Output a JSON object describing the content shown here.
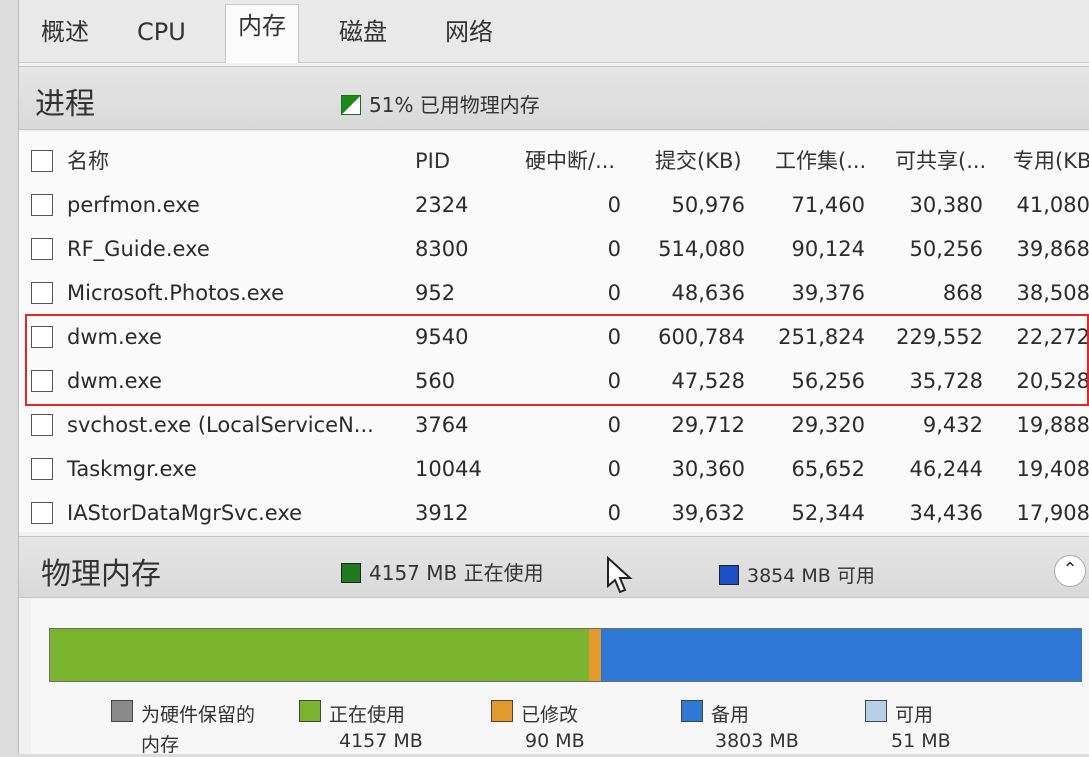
{
  "tabs": [
    "概述",
    "CPU",
    "内存",
    "磁盘",
    "网络"
  ],
  "process_section": {
    "title": "进程",
    "summary": "51% 已用物理内存",
    "summary_color": "#1d8a1d"
  },
  "table": {
    "columns": [
      "名称",
      "PID",
      "硬中断/...",
      "提交(KB)",
      "工作集(...",
      "可共享(...",
      "专用(KB"
    ],
    "rows": [
      [
        "perfmon.exe",
        "2324",
        "0",
        "50,976",
        "71,460",
        "30,380",
        "41,080"
      ],
      [
        "RF_Guide.exe",
        "8300",
        "0",
        "514,080",
        "90,124",
        "50,256",
        "39,868"
      ],
      [
        "Microsoft.Photos.exe",
        "952",
        "0",
        "48,636",
        "39,376",
        "868",
        "38,508"
      ],
      [
        "dwm.exe",
        "9540",
        "0",
        "600,784",
        "251,824",
        "229,552",
        "22,272"
      ],
      [
        "dwm.exe",
        "560",
        "0",
        "47,528",
        "56,256",
        "35,728",
        "20,528"
      ],
      [
        "svchost.exe (LocalServiceN...",
        "3764",
        "0",
        "29,712",
        "29,320",
        "9,432",
        "19,888"
      ],
      [
        "Taskmgr.exe",
        "10044",
        "0",
        "30,360",
        "65,652",
        "46,244",
        "19,408"
      ],
      [
        "IAStorDataMgrSvc.exe",
        "3912",
        "0",
        "39,632",
        "52,344",
        "34,436",
        "17,908"
      ]
    ]
  },
  "memory_section": {
    "title": "物理内存",
    "in_use_summary": "4157 MB 正在使用",
    "available_summary": "3854 MB 可用",
    "in_use_color": "#1f7a1f",
    "available_color": "#1b4fc8"
  },
  "memory_bar": {
    "segments": [
      {
        "name": "reserved",
        "fraction": 0.0,
        "color": "#8a8a8a"
      },
      {
        "name": "in-use",
        "fraction": 0.5225,
        "color": "#7ab32e"
      },
      {
        "name": "modified",
        "fraction": 0.0113,
        "color": "#e39a2c"
      },
      {
        "name": "standby",
        "fraction": 0.4662,
        "color": "#2f78d6"
      },
      {
        "name": "free",
        "fraction": 0.0,
        "color": "#b8cfe8"
      }
    ]
  },
  "legend": [
    {
      "label": "为硬件保留的",
      "value": "内存",
      "color": "#8a8a8a"
    },
    {
      "label": "正在使用",
      "value": "4157 MB",
      "color": "#7ab32e"
    },
    {
      "label": "已修改",
      "value": "90 MB",
      "color": "#e39a2c"
    },
    {
      "label": "备用",
      "value": "3803 MB",
      "color": "#2f78d6"
    },
    {
      "label": "可用",
      "value": "51 MB",
      "color": "#b8cfe8"
    }
  ]
}
